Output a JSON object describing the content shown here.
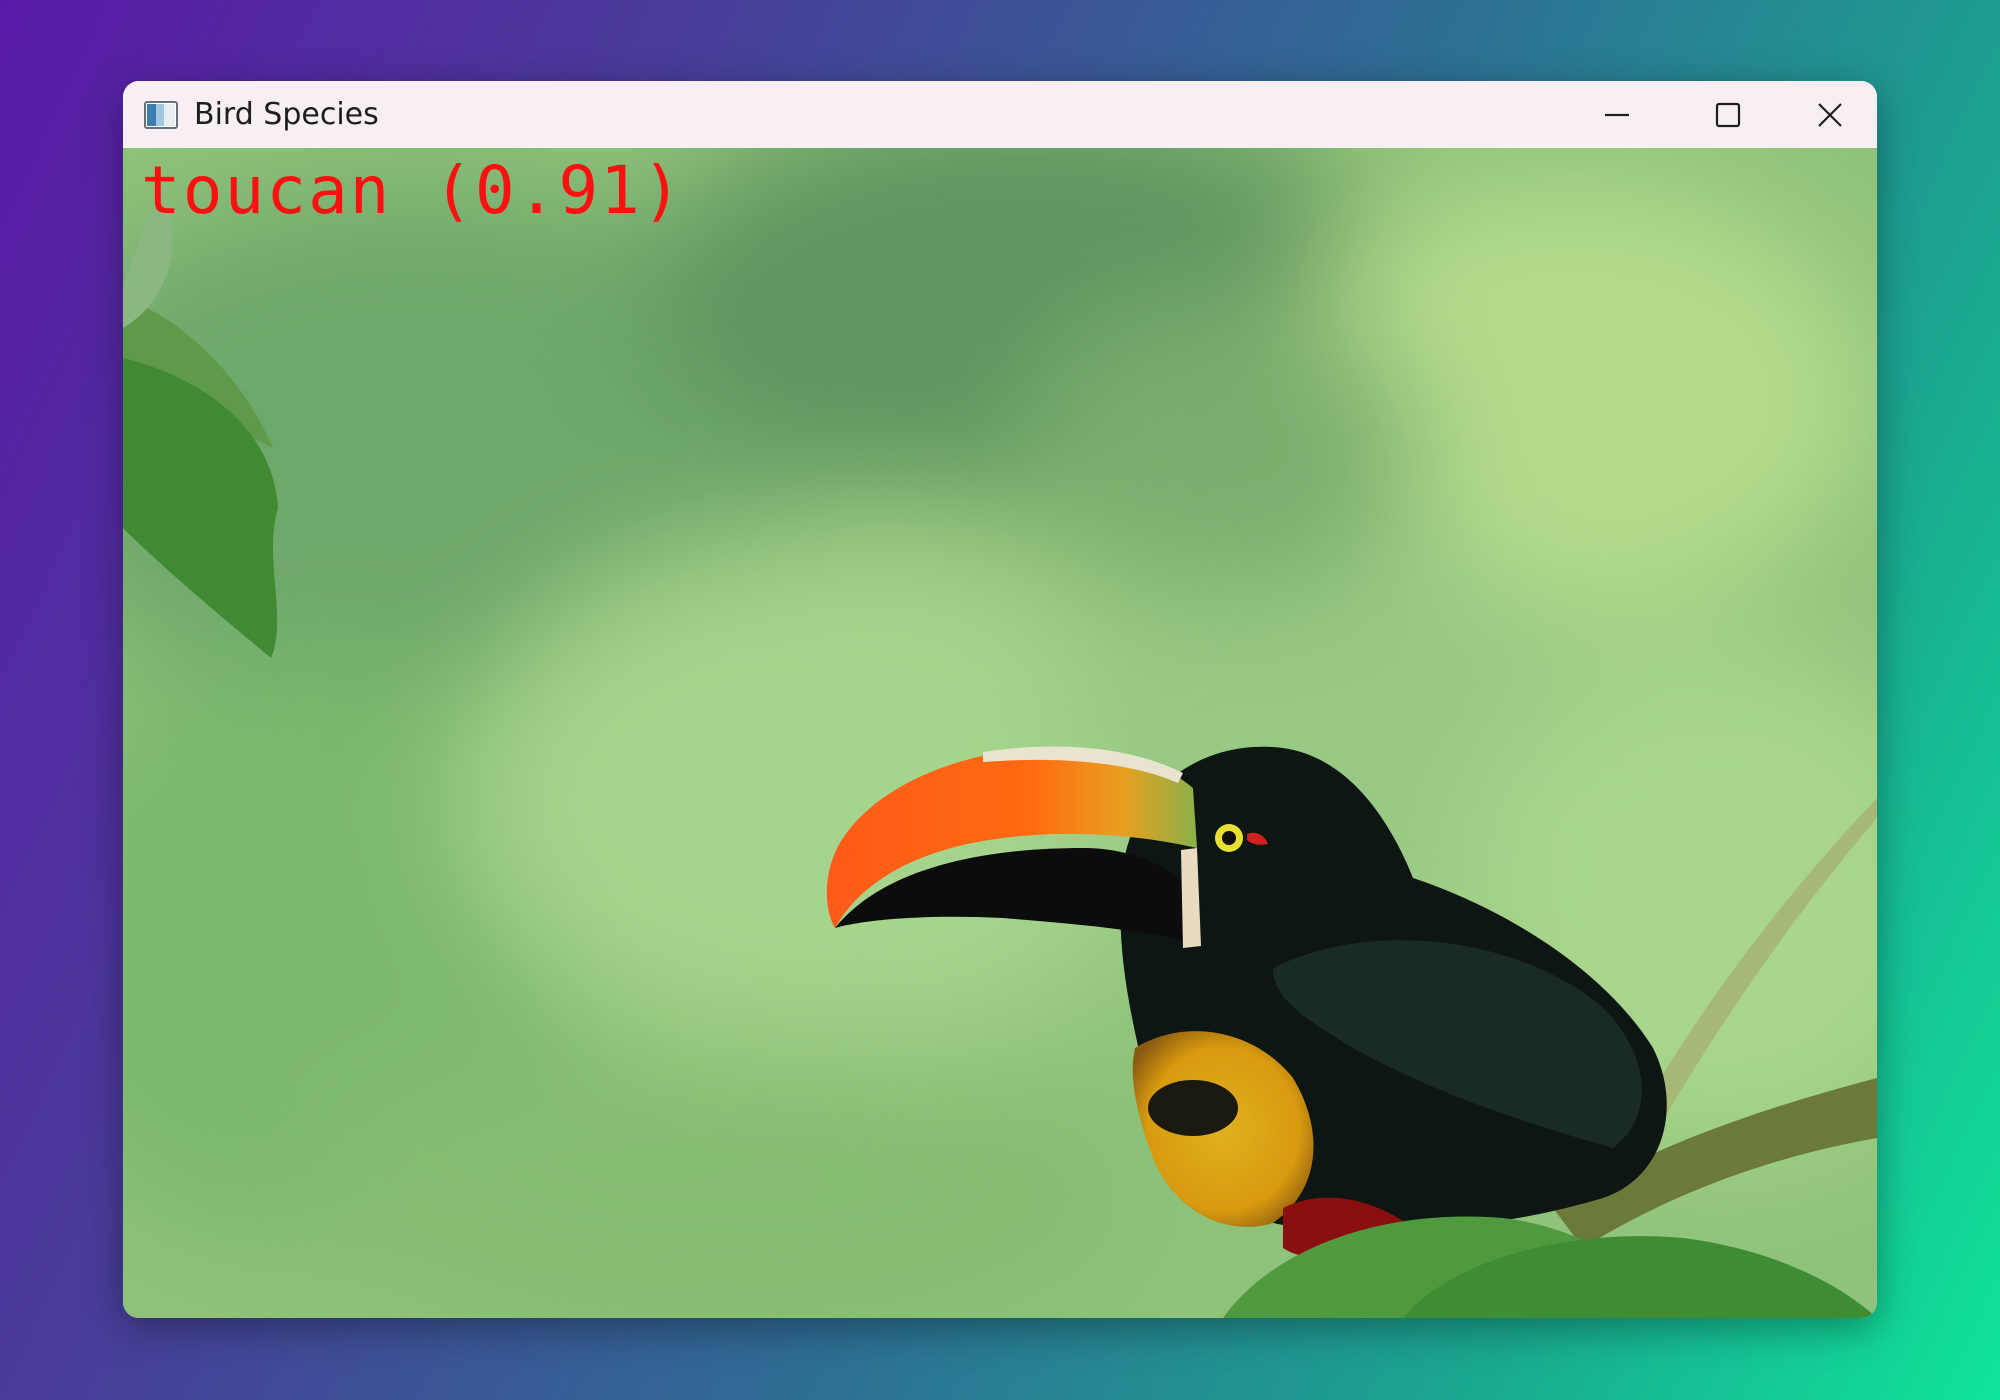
{
  "window": {
    "title": "Bird Species",
    "app_icon": "opencv-window-icon",
    "controls": {
      "minimize": "minimize-icon",
      "maximize": "maximize-icon",
      "close": "close-icon"
    }
  },
  "detection": {
    "label_text": "toucan (0.91)",
    "species": "toucan",
    "confidence": 0.91,
    "text_color": "#ff1010"
  },
  "colors": {
    "background_gradient_start": "#5a1aa8",
    "background_gradient_end": "#10e49a",
    "titlebar": "#f7eff3"
  }
}
